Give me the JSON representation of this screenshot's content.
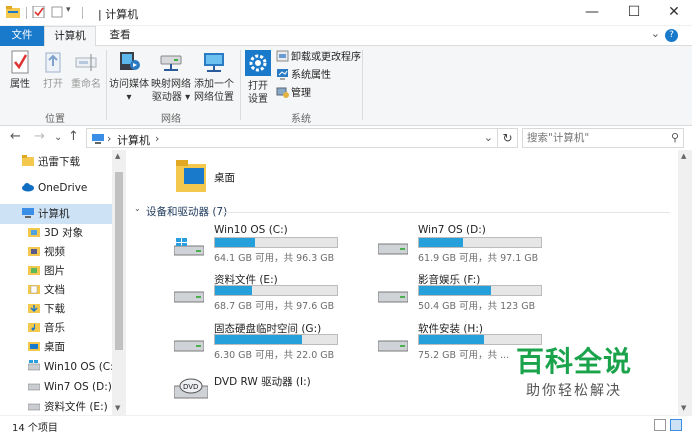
{
  "window": {
    "title": "计算机",
    "title_prefix": "| ",
    "minimize": "—",
    "maximize": "☐",
    "close": "✕"
  },
  "tabs": {
    "file": "文件",
    "computer": "计算机",
    "view": "查看",
    "help": "?",
    "collapse": "⌄"
  },
  "ribbon": {
    "location_group": {
      "label": "位置",
      "properties": "属性",
      "open": "打开",
      "rename": "重命名"
    },
    "network_group": {
      "label": "网络",
      "access_media": [
        "访问媒体",
        "▾"
      ],
      "map_drive": [
        "映射网络",
        "驱动器 ▾"
      ],
      "add_location": [
        "添加一个",
        "网络位置"
      ]
    },
    "system_group": {
      "label": "系统",
      "open_settings": [
        "打开",
        "设置"
      ],
      "uninstall": "卸载或更改程序",
      "system_properties": "系统属性",
      "manage": "管理"
    }
  },
  "address": {
    "path": "计算机",
    "back": "←",
    "forward": "→",
    "recent": "⌄",
    "up": "↑",
    "chevron": "›",
    "end_chevron": "›",
    "dropdown": "⌄",
    "refresh": "↻",
    "search_placeholder": "搜索\"计算机\"",
    "search_icon": "⚲"
  },
  "sidebar": {
    "items": [
      {
        "label": "迅雷下载"
      },
      {
        "label": "OneDrive"
      },
      {
        "label": "计算机"
      },
      {
        "label": "3D 对象"
      },
      {
        "label": "视频"
      },
      {
        "label": "图片"
      },
      {
        "label": "文档"
      },
      {
        "label": "下载"
      },
      {
        "label": "音乐"
      },
      {
        "label": "桌面"
      },
      {
        "label": "Win10 OS (C:)"
      },
      {
        "label": "Win7 OS (D:)"
      },
      {
        "label": "资料文件 (E:)"
      }
    ]
  },
  "main": {
    "folder": "桌面",
    "section_title": "设备和驱动器 (7)",
    "drives": [
      {
        "name": "Win10 OS (C:)",
        "info": "64.1 GB 可用，共 96.3 GB",
        "used_fraction": 0.33
      },
      {
        "name": "Win7 OS (D:)",
        "info": "61.9 GB 可用，共 97.1 GB",
        "used_fraction": 0.36
      },
      {
        "name": "资料文件 (E:)",
        "info": "68.7 GB 可用，共 97.6 GB",
        "used_fraction": 0.3
      },
      {
        "name": "影音娱乐 (F:)",
        "info": "50.4 GB 可用，共 123 GB",
        "used_fraction": 0.59
      },
      {
        "name": "固态硬盘临时空间 (G:)",
        "info": "6.30 GB 可用，共 22.0 GB",
        "used_fraction": 0.71
      },
      {
        "name": "软件安装 (H:)",
        "info": "75.2 GB 可用，共 ...",
        "used_fraction": 0.53
      },
      {
        "name": "DVD RW 驱动器 (I:)",
        "info": ""
      }
    ]
  },
  "status": {
    "items": "14 个项目"
  },
  "watermark": {
    "brand": "百科全说",
    "tagline": "助你轻松解决"
  },
  "colors": {
    "accent": "#1979ca",
    "bar_fill": "#26a0da",
    "selection": "#cde2f5",
    "watermark": "#1aa34a"
  }
}
